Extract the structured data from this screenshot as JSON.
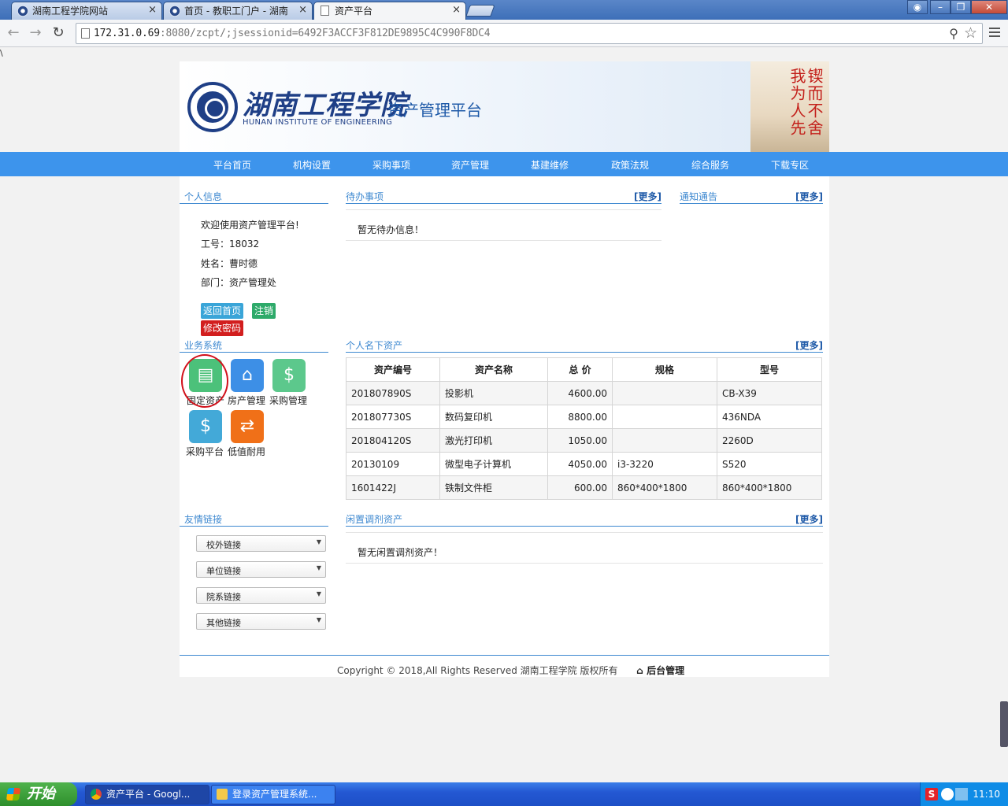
{
  "browser": {
    "tabs": [
      {
        "label": "湖南工程学院网站",
        "close": "×"
      },
      {
        "label": "首页 - 教职工门户 - 湖南",
        "close": "×"
      },
      {
        "label": "资产平台",
        "close": "×"
      }
    ],
    "url_host": "172.31.0.69",
    "url_rest": ":8080/zcpt/;jsessionid=6492F3ACCF3F812DE9895C4C990F8DC4",
    "stray_char": "\\"
  },
  "banner": {
    "school_cn": "湖南工程学院",
    "school_en": "HUNAN INSTITUTE OF ENGINEERING",
    "platform": "资产管理平台",
    "calligraphy": "锲而不舍 我为人先"
  },
  "nav": [
    "平台首页",
    "机构设置",
    "采购事项",
    "资产管理",
    "基建维修",
    "政策法规",
    "综合服务",
    "下载专区"
  ],
  "personal": {
    "heading": "个人信息",
    "welcome": "欢迎使用资产管理平台!",
    "id_line": "工号：18032",
    "name_line": "姓名：曹时德",
    "dept_line": "部门：资产管理处",
    "btn_home": "返回首页",
    "btn_logout": "注销",
    "btn_pwd": "修改密码"
  },
  "todo": {
    "heading": "待办事项",
    "more": "[更多]",
    "empty": "暂无待办信息！"
  },
  "notice": {
    "heading": "通知通告",
    "more": "[更多]"
  },
  "business": {
    "heading": "业务系统",
    "items": [
      {
        "label": "固定资产",
        "icon": "document-icon",
        "color": "#4cc17a"
      },
      {
        "label": "房产管理",
        "icon": "house-search-icon",
        "color": "#3d8fe6"
      },
      {
        "label": "采购管理",
        "icon": "dollar-search-icon",
        "color": "#5cc88c"
      },
      {
        "label": "采购平台",
        "icon": "hand-money-icon",
        "color": "#43a9d8"
      },
      {
        "label": "低值耐用",
        "icon": "transfer-icon",
        "color": "#f07018"
      }
    ]
  },
  "assets": {
    "heading": "个人名下资产",
    "more": "[更多]",
    "columns": [
      "资产编号",
      "资产名称",
      "总 价",
      "规格",
      "型号"
    ],
    "rows": [
      [
        "201807890S",
        "投影机",
        "4600.00",
        "",
        "CB-X39"
      ],
      [
        "201807730S",
        "数码复印机",
        "8800.00",
        "",
        "436NDA"
      ],
      [
        "201804120S",
        "激光打印机",
        "1050.00",
        "",
        "2260D"
      ],
      [
        "20130109",
        "微型电子计算机",
        "4050.00",
        "i3-3220",
        "S520"
      ],
      [
        "1601422J",
        "铁制文件柜",
        "600.00",
        "860*400*1800",
        "860*400*1800"
      ]
    ]
  },
  "links": {
    "heading": "友情链接",
    "selects": [
      "校外链接",
      "单位链接",
      "院系链接",
      "其他链接"
    ]
  },
  "idle": {
    "heading": "闲置调剂资产",
    "more": "[更多]",
    "empty": "暂无闲置调剂资产！"
  },
  "footer": {
    "copyright": "Copyright © 2018,All Rights Reserved 湖南工程学院  版权所有",
    "admin": "后台管理"
  },
  "taskbar": {
    "start": "开始",
    "tasks": [
      "资产平台 - Googl...",
      "登录资产管理系统..."
    ],
    "clock": "11:10"
  }
}
